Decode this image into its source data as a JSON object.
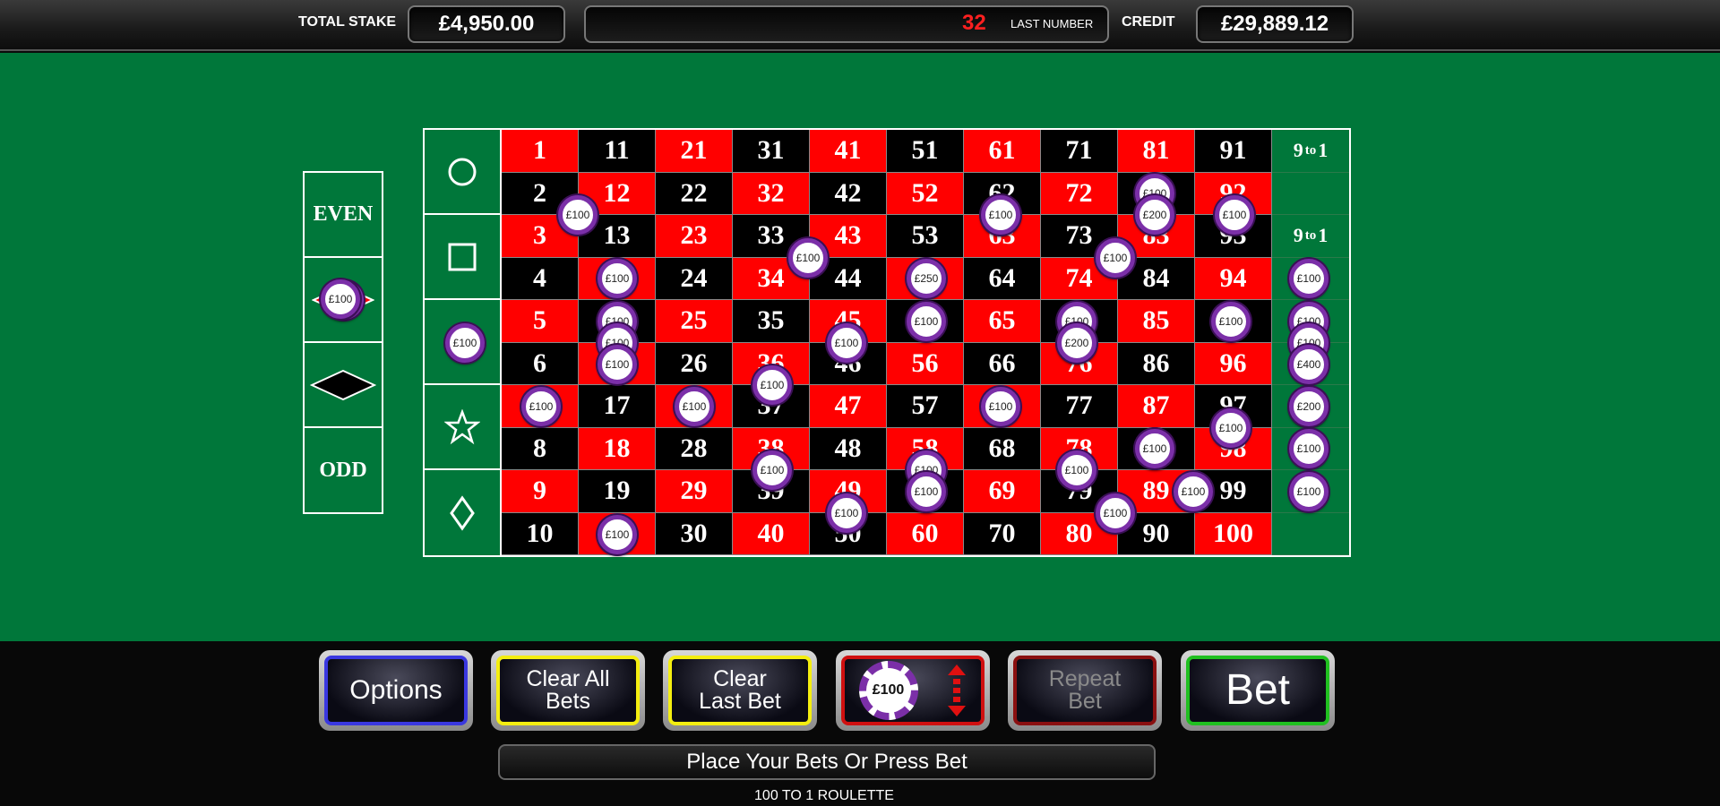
{
  "header": {
    "total_stake_label": "TOTAL STAKE",
    "total_stake": "£4,950.00",
    "last_number": "32",
    "last_number_label": "LAST NUMBER",
    "credit_label": "CREDIT",
    "credit": "£29,889.12"
  },
  "side_bets": [
    "EVEN",
    "",
    "",
    "ODD"
  ],
  "grid": {
    "rows": [
      [
        1,
        11,
        21,
        31,
        41,
        51,
        61,
        71,
        81,
        91
      ],
      [
        2,
        12,
        22,
        32,
        42,
        52,
        62,
        72,
        82,
        92
      ],
      [
        3,
        13,
        23,
        33,
        43,
        53,
        63,
        73,
        83,
        93
      ],
      [
        4,
        14,
        24,
        34,
        44,
        54,
        64,
        74,
        84,
        94
      ],
      [
        5,
        15,
        25,
        35,
        45,
        55,
        65,
        75,
        85,
        95
      ],
      [
        6,
        16,
        26,
        36,
        46,
        56,
        66,
        76,
        86,
        96
      ],
      [
        7,
        17,
        27,
        37,
        47,
        57,
        67,
        77,
        87,
        97
      ],
      [
        8,
        18,
        28,
        38,
        48,
        58,
        68,
        78,
        88,
        98
      ],
      [
        9,
        19,
        29,
        39,
        49,
        59,
        69,
        79,
        89,
        99
      ],
      [
        10,
        20,
        30,
        40,
        50,
        60,
        70,
        80,
        90,
        100
      ]
    ],
    "red_numbers": [
      1,
      12,
      21,
      32,
      41,
      52,
      61,
      72,
      81,
      92,
      3,
      14,
      23,
      34,
      43,
      54,
      63,
      74,
      83,
      94,
      5,
      16,
      25,
      36,
      45,
      56,
      65,
      76,
      85,
      96,
      7,
      18,
      27,
      38,
      47,
      58,
      67,
      78,
      87,
      98,
      9,
      20,
      29,
      40,
      49,
      60,
      69,
      80,
      89,
      100
    ],
    "payout_text": "9 to 1",
    "payout_parts": [
      "9",
      "to",
      "1"
    ],
    "symbols": [
      "circle-icon",
      "square-icon",
      "chip",
      "star-icon",
      "diamond-outline-icon"
    ]
  },
  "chip_value": "£100",
  "chips": [
    {
      "label": "£100"
    },
    {
      "label": "£100"
    },
    {
      "label": "£200"
    },
    {
      "label": "£200"
    },
    {
      "label": "£100"
    },
    {
      "label": "£100"
    },
    {
      "label": "£100"
    },
    {
      "label": "£100"
    },
    {
      "label": "£250"
    },
    {
      "label": "£100"
    },
    {
      "label": "£100"
    },
    {
      "label": "£100"
    },
    {
      "label": "£100"
    },
    {
      "label": "£100"
    },
    {
      "label": "£100"
    },
    {
      "label": "£100"
    },
    {
      "label": "£100"
    },
    {
      "label": "£100"
    },
    {
      "label": "£100"
    },
    {
      "label": "£200"
    },
    {
      "label": "£100"
    },
    {
      "label": "£100"
    },
    {
      "label": "£400"
    },
    {
      "label": "£100"
    },
    {
      "label": "£100"
    },
    {
      "label": "£100"
    },
    {
      "label": "£100"
    },
    {
      "label": "£100"
    },
    {
      "label": "£200"
    },
    {
      "label": "£100"
    },
    {
      "label": "£100"
    },
    {
      "label": "£100"
    },
    {
      "label": "£100"
    },
    {
      "label": "£100"
    },
    {
      "label": "£100"
    },
    {
      "label": "£100"
    },
    {
      "label": "£100"
    },
    {
      "label": "£100"
    },
    {
      "label": "£100"
    },
    {
      "label": "£100"
    },
    {
      "label": "£100"
    },
    {
      "label": "£100"
    },
    {
      "label": "£100"
    },
    {
      "label": "£100"
    },
    {
      "label": "£100"
    },
    {
      "label": "£100"
    }
  ],
  "buttons": {
    "options": "Options",
    "clear_all_1": "Clear All",
    "clear_all_2": "Bets",
    "clear_last_1": "Clear",
    "clear_last_2": "Last Bet",
    "chip_select": "£100",
    "repeat_1": "Repeat",
    "repeat_2": "Bet",
    "bet": "Bet"
  },
  "colors": {
    "felt": "#00773a",
    "red": "#ff0000",
    "black": "#000000",
    "chip_ring": "#7b2fa8"
  },
  "status": "Place Your Bets Or Press Bet",
  "game_title": "100 TO 1 ROULETTE"
}
